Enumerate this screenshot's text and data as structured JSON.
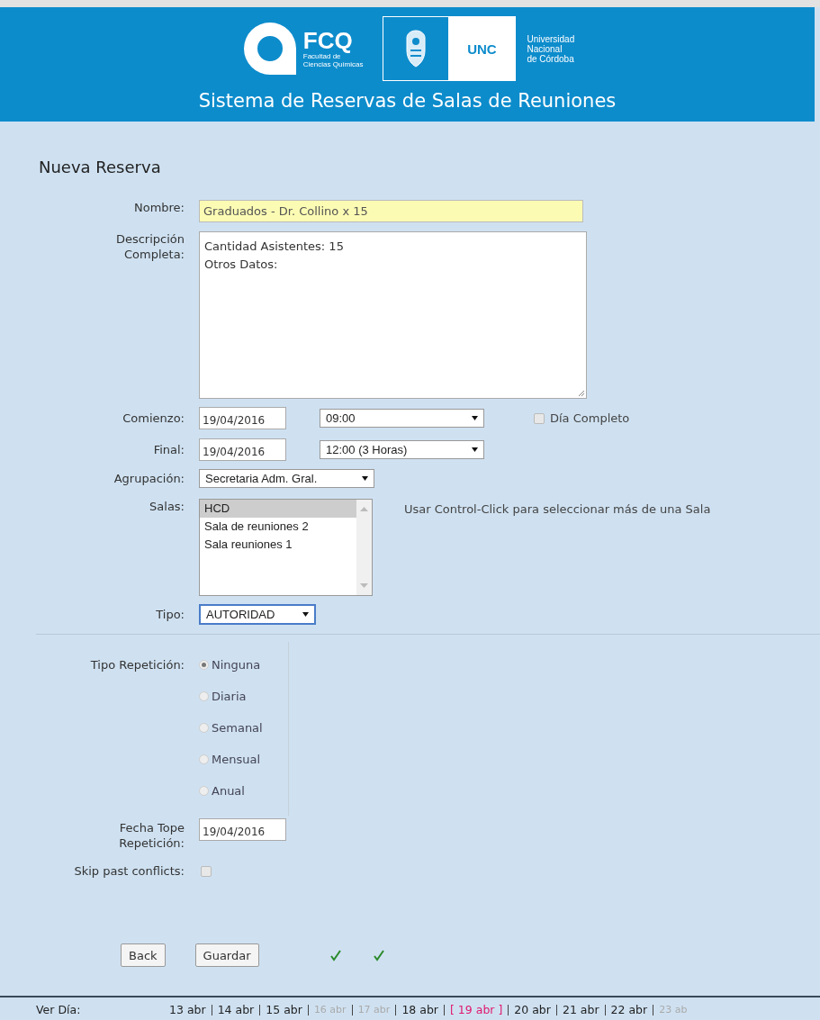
{
  "header": {
    "fcq": {
      "acronym": "FCQ",
      "line_1": "Facultad de",
      "line_2": "Ciencias Químicas"
    },
    "unc": {
      "acronym": "UNC",
      "lines": [
        "Universidad",
        "Nacional",
        "de Córdoba"
      ]
    },
    "title": "Sistema de Reservas de Salas de Reuniones"
  },
  "heading": "Nueva Reserva",
  "form": {
    "nombre": {
      "label": "Nombre:",
      "value": "Graduados - Dr. Collino x 15"
    },
    "descripcion": {
      "label_lines": [
        "Descripción",
        "Completa:"
      ],
      "lines": [
        "Cantidad Asistentes: 15",
        "Otros Datos:"
      ]
    },
    "comienzo": {
      "label": "Comienzo:",
      "date": "19/04/2016",
      "time": "09:00",
      "all_day": {
        "label": "Día Completo",
        "checked": false
      }
    },
    "final": {
      "label": "Final:",
      "date": "19/04/2016",
      "time": "12:00  (3 Horas)"
    },
    "agrupacion": {
      "label": "Agrupación:",
      "value": "Secretaria Adm. Gral."
    },
    "salas": {
      "label": "Salas:",
      "hint": "Usar Control-Click para seleccionar más de una Sala",
      "options": [
        {
          "label": "HCD",
          "selected": true
        },
        {
          "label": "Sala de reuniones 2",
          "selected": false
        },
        {
          "label": "Sala reuniones 1",
          "selected": false
        }
      ]
    },
    "tipo": {
      "label": "Tipo:",
      "value": "AUTORIDAD"
    },
    "repeticion": {
      "label": "Tipo Repetición:",
      "options": [
        {
          "label": "Ninguna",
          "selected": true
        },
        {
          "label": "Diaria",
          "selected": false
        },
        {
          "label": "Semanal",
          "selected": false
        },
        {
          "label": "Mensual",
          "selected": false
        },
        {
          "label": "Anual",
          "selected": false
        }
      ]
    },
    "fecha_tope": {
      "label_lines": [
        "Fecha Tope",
        "Repetición:"
      ],
      "value": "19/04/2016"
    },
    "skip": {
      "label": "Skip past conflicts:",
      "checked": false
    }
  },
  "buttons": [
    "Back",
    "Guardar"
  ],
  "status_icons": [
    {
      "kind": "check"
    },
    {
      "kind": "check"
    }
  ],
  "day_nav": {
    "label": "Ver Día:",
    "days": [
      {
        "text": "13 abr",
        "kind": "normal"
      },
      {
        "text": "14 abr",
        "kind": "normal"
      },
      {
        "text": "15 abr",
        "kind": "normal"
      },
      {
        "text": "16 abr",
        "kind": "weekend"
      },
      {
        "text": "17 abr",
        "kind": "weekend"
      },
      {
        "text": "18 abr",
        "kind": "normal"
      },
      {
        "text": "[ 19 abr ]",
        "kind": "current"
      },
      {
        "text": "20 abr",
        "kind": "normal"
      },
      {
        "text": "21 abr",
        "kind": "normal"
      },
      {
        "text": "22 abr",
        "kind": "normal"
      },
      {
        "text": "23 ab",
        "kind": "weekend"
      }
    ]
  }
}
